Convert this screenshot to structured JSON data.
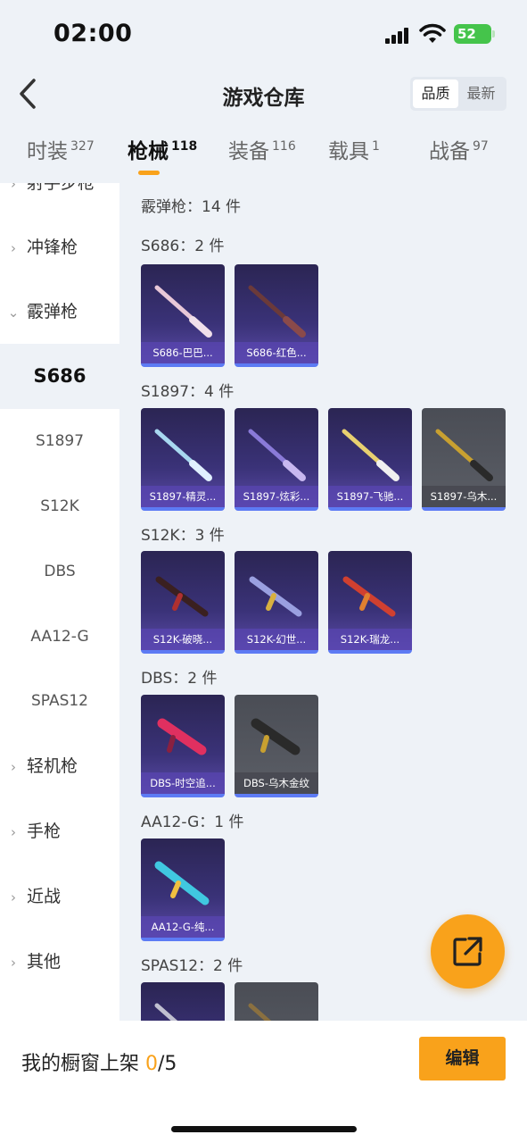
{
  "status": {
    "time": "02:00",
    "battery": "52"
  },
  "nav": {
    "title": "游戏仓库",
    "sort_quality": "品质",
    "sort_newest": "最新"
  },
  "tabs": [
    {
      "label": "时装",
      "count": "327"
    },
    {
      "label": "枪械",
      "count": "118"
    },
    {
      "label": "装备",
      "count": "116"
    },
    {
      "label": "载具",
      "count": "1"
    },
    {
      "label": "战备",
      "count": "97"
    }
  ],
  "sidebar": {
    "items": [
      {
        "label": "射手步枪"
      },
      {
        "label": "冲锋枪"
      },
      {
        "label": "霰弹枪"
      },
      {
        "label": "S686"
      },
      {
        "label": "S1897"
      },
      {
        "label": "S12K"
      },
      {
        "label": "DBS"
      },
      {
        "label": "AA12-G"
      },
      {
        "label": "SPAS12"
      },
      {
        "label": "轻机枪"
      },
      {
        "label": "手枪"
      },
      {
        "label": "近战"
      },
      {
        "label": "其他"
      }
    ]
  },
  "main": {
    "category_title": "霰弹枪：14 件",
    "groups": [
      {
        "title": "S686：2 件",
        "items": [
          "S686-巴巴...",
          "S686-红色..."
        ]
      },
      {
        "title": "S1897：4 件",
        "items": [
          "S1897-精灵...",
          "S1897-炫彩...",
          "S1897-飞驰...",
          "S1897-乌木..."
        ]
      },
      {
        "title": "S12K：3 件",
        "items": [
          "S12K-破晓...",
          "S12K-幻世...",
          "S12K-瑞龙..."
        ]
      },
      {
        "title": "DBS：2 件",
        "items": [
          "DBS-时空追...",
          "DBS-乌木金纹"
        ]
      },
      {
        "title": "AA12-G：1 件",
        "items": [
          "AA12-G-纯..."
        ]
      },
      {
        "title": "SPAS12：2 件",
        "items": [
          "",
          ""
        ]
      }
    ]
  },
  "bottom": {
    "shelf_label": "我的橱窗上架 ",
    "shelf_used": "0",
    "shelf_total": "/5",
    "edit": "编辑"
  },
  "colors": {
    "accent": "#f9a21b",
    "card_purple": "#3a3278",
    "card_gray": "#5b5e66"
  }
}
